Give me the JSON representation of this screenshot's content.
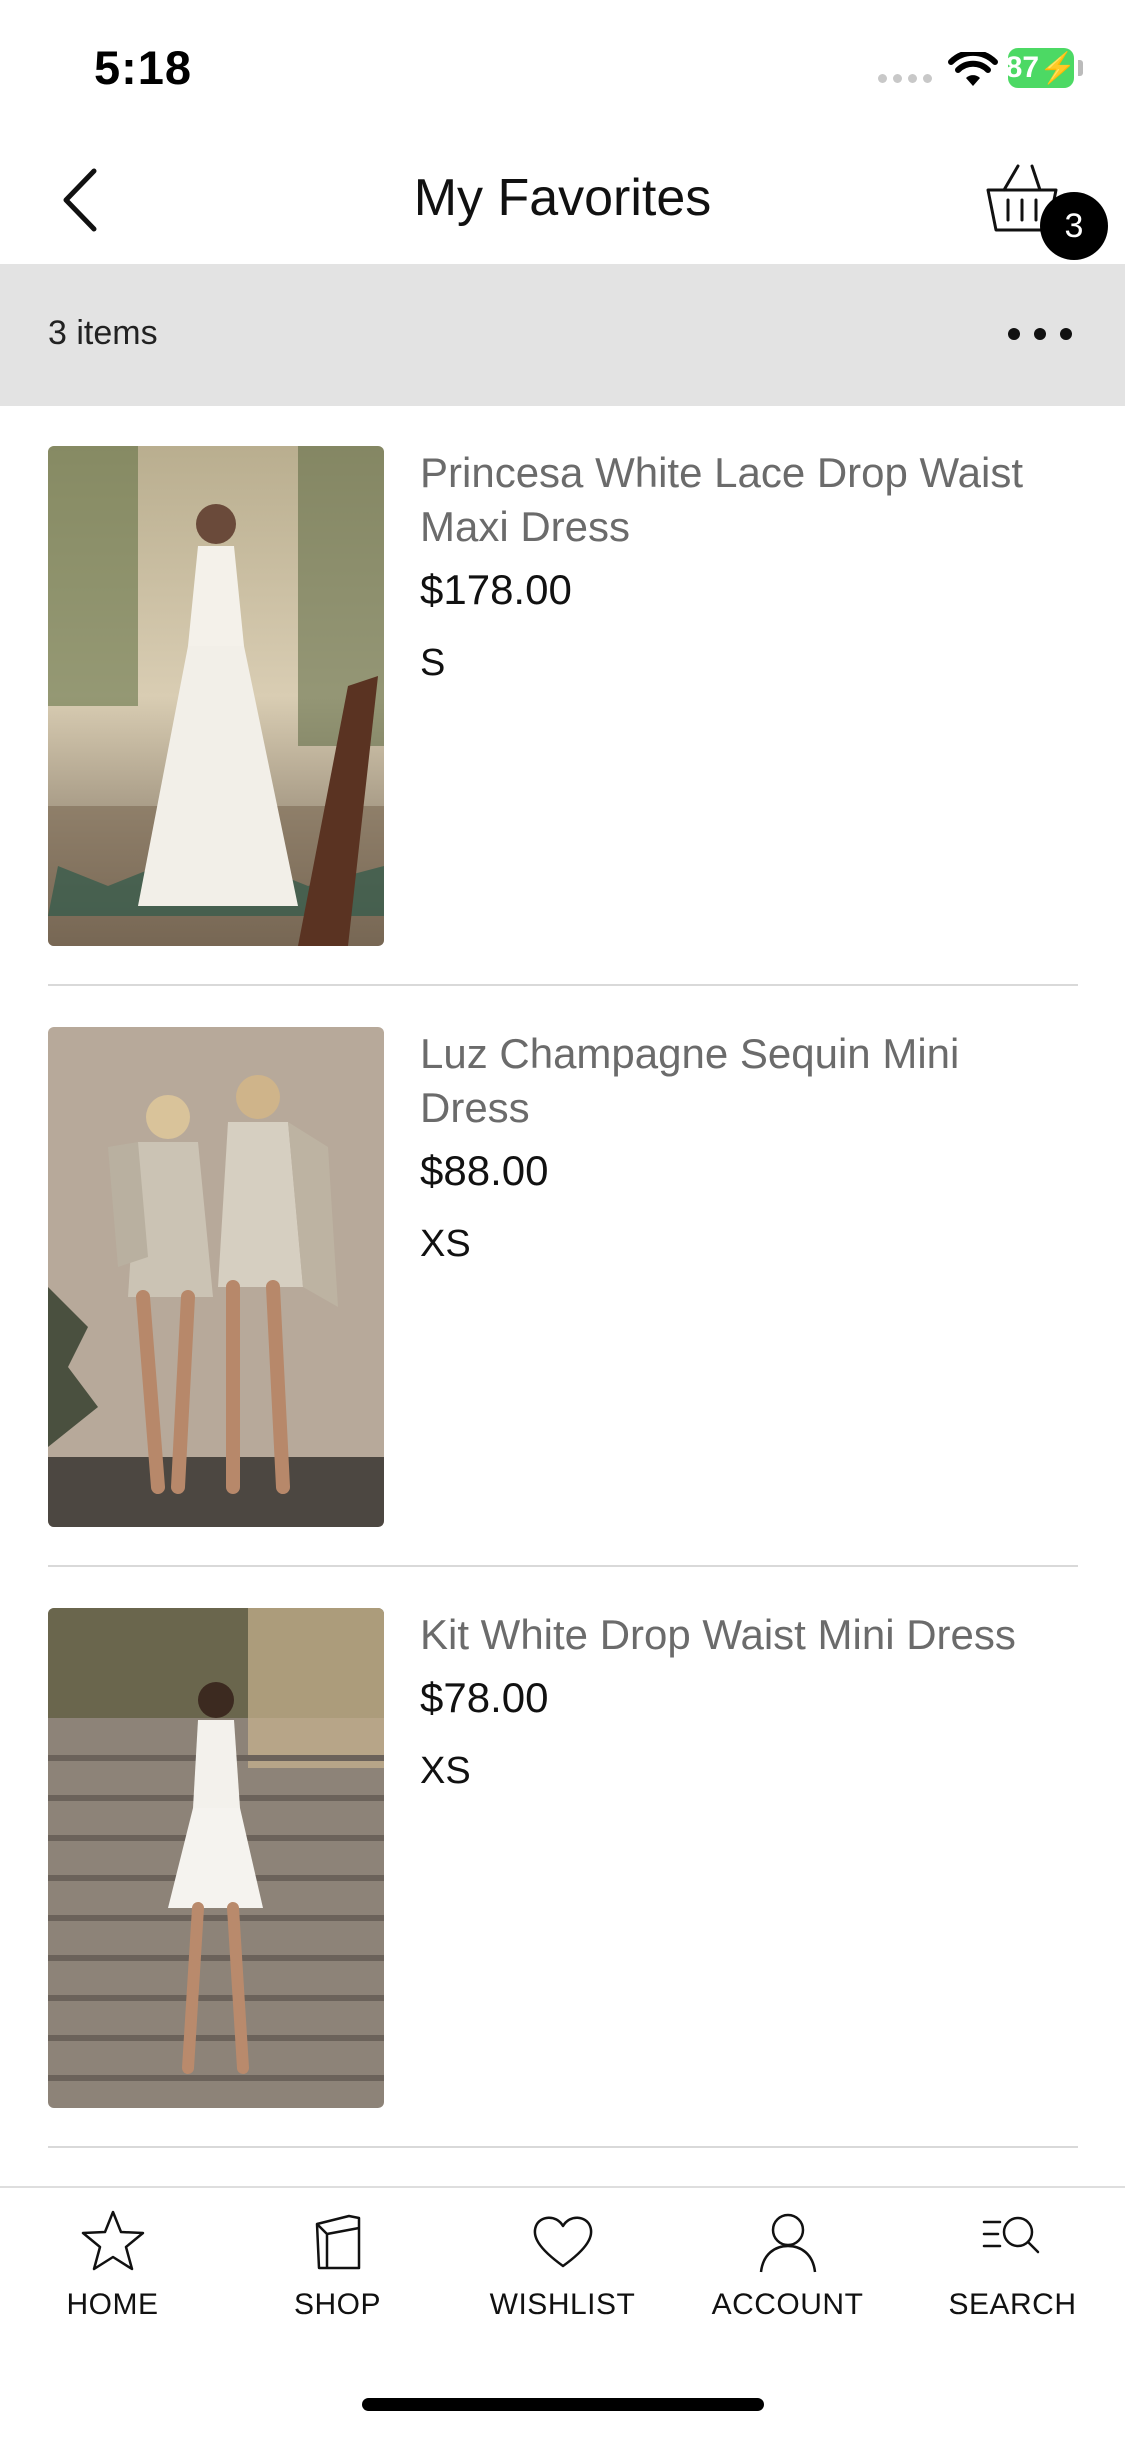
{
  "status": {
    "time": "5:18",
    "battery": "87"
  },
  "header": {
    "title": "My Favorites",
    "cart_count": "3"
  },
  "list_bar": {
    "count_label": "3 items"
  },
  "products": [
    {
      "name": "Princesa White Lace Drop Waist Maxi Dress",
      "price": "$178.00",
      "size": "S"
    },
    {
      "name": "Luz Champagne Sequin Mini Dress",
      "price": "$88.00",
      "size": "XS"
    },
    {
      "name": "Kit White Drop Waist Mini Dress",
      "price": "$78.00",
      "size": "XS"
    }
  ],
  "tabs": [
    {
      "label": "HOME",
      "icon": "star-icon"
    },
    {
      "label": "SHOP",
      "icon": "shopping-bag-icon"
    },
    {
      "label": "WISHLIST",
      "icon": "heart-icon"
    },
    {
      "label": "ACCOUNT",
      "icon": "person-icon"
    },
    {
      "label": "SEARCH",
      "icon": "search-icon"
    }
  ],
  "colors": {
    "accent": "#000000",
    "battery": "#4cd964",
    "items_bar": "#e3e3e3",
    "product_name": "#6b6b6b"
  }
}
